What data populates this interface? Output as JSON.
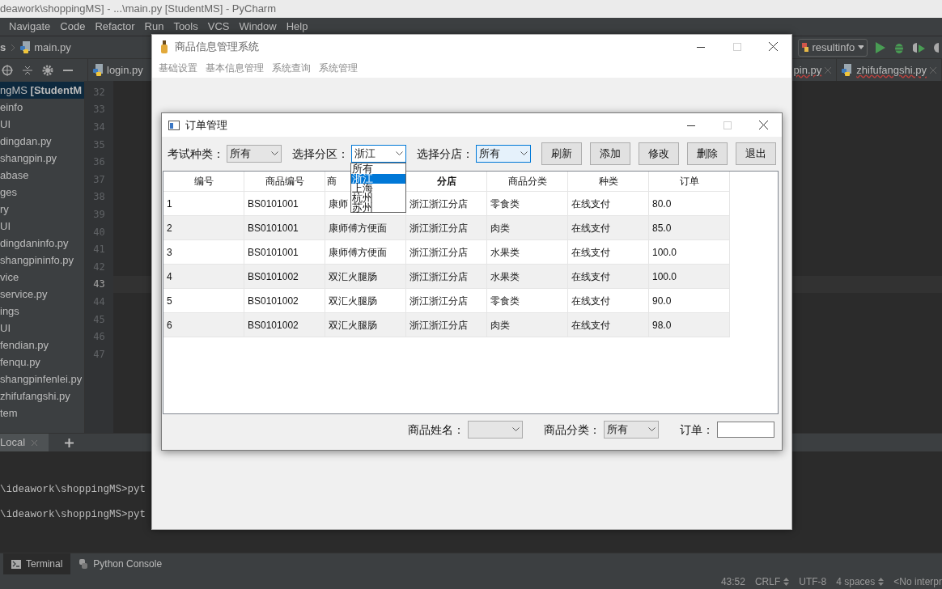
{
  "ide": {
    "title": "deawork\\shoppingMS] - ...\\main.py [StudentMS] - PyCharm",
    "menu": [
      "Navigate",
      "Code",
      "Refactor",
      "Run",
      "Tools",
      "VCS",
      "Window",
      "Help"
    ],
    "breadcrumb": [
      "s",
      "main.py"
    ],
    "run_config": "resultinfo",
    "editor_tabs_left": [
      "login.py"
    ],
    "editor_tabs_right": [
      "pin.py",
      "zhifufangshi.py"
    ],
    "project_items": [
      {
        "label": "ngMS **[StudentM**",
        "selected": true
      },
      {
        "label": "einfo",
        "selected": false
      },
      {
        "label": "UI",
        "selected": false
      },
      {
        "label": "dingdan.py",
        "selected": false
      },
      {
        "label": "shangpin.py",
        "selected": false
      },
      {
        "label": "abase",
        "selected": false
      },
      {
        "label": "ges",
        "selected": false
      },
      {
        "label": "ry",
        "selected": false
      },
      {
        "label": "UI",
        "selected": false
      },
      {
        "label": "dingdaninfo.py",
        "selected": false
      },
      {
        "label": "shangpininfo.py",
        "selected": false
      },
      {
        "label": "vice",
        "selected": false
      },
      {
        "label": "service.py",
        "selected": false
      },
      {
        "label": "ings",
        "selected": false
      },
      {
        "label": "UI",
        "selected": false
      },
      {
        "label": "fendian.py",
        "selected": false
      },
      {
        "label": "fenqu.py",
        "selected": false
      },
      {
        "label": "shangpinfenlei.py",
        "selected": false
      },
      {
        "label": "zhifufangshi.py",
        "selected": false
      },
      {
        "label": "tem",
        "selected": false
      }
    ],
    "line_numbers": [
      {
        "text": "32",
        "current": false
      },
      {
        "text": "33",
        "current": false
      },
      {
        "text": "34",
        "current": false
      },
      {
        "text": "35",
        "current": false
      },
      {
        "text": "36",
        "current": false
      },
      {
        "text": "37",
        "current": false
      },
      {
        "text": "38",
        "current": false
      },
      {
        "text": "39",
        "current": false
      },
      {
        "text": "40",
        "current": false
      },
      {
        "text": "41",
        "current": false
      },
      {
        "text": "42",
        "current": false
      },
      {
        "text": "43",
        "current": true
      },
      {
        "text": "44",
        "current": false
      },
      {
        "text": "45",
        "current": false
      },
      {
        "text": "46",
        "current": false
      },
      {
        "text": "47",
        "current": false
      }
    ],
    "terminal": {
      "tab": "Local",
      "lines": [
        "\\ideawork\\shoppingMS>pyt",
        "\\ideawork\\shoppingMS>pyt"
      ]
    },
    "tool_tabs": [
      {
        "label": "Terminal",
        "selected": true
      },
      {
        "label": "Python Console",
        "selected": false
      }
    ],
    "status_bar": [
      {
        "text": "43:52",
        "kind": "plain"
      },
      {
        "text": "CRLF",
        "kind": "menu"
      },
      {
        "text": "UTF-8",
        "kind": "plain"
      },
      {
        "text": "4 spaces",
        "kind": "menu"
      },
      {
        "text": "<No interpr",
        "kind": "plain"
      }
    ]
  },
  "app": {
    "title": "商品信息管理系统",
    "menu": [
      "基础设置",
      "基本信息管理",
      "系统查询",
      "系统管理"
    ],
    "dialog": {
      "title": "订单管理",
      "filters": [
        {
          "label": "考试种类：",
          "value": "所有",
          "focused": false,
          "hovered": false
        },
        {
          "label": "选择分区：",
          "value": "浙江",
          "focused": true,
          "hovered": false
        },
        {
          "label": "选择分店：",
          "value": "所有",
          "focused": false,
          "hovered": true
        }
      ],
      "buttons": [
        "刷新",
        "添加",
        "修改",
        "删除",
        "退出"
      ],
      "dropdown": [
        {
          "label": "所有",
          "selected": false
        },
        {
          "label": "浙江",
          "selected": true
        },
        {
          "label": "上海",
          "selected": false
        },
        {
          "label": "杭州",
          "selected": false
        },
        {
          "label": "苏州",
          "selected": false
        }
      ],
      "table": {
        "columns": [
          {
            "label": "编号",
            "sorted": false
          },
          {
            "label": "商品编号",
            "sorted": false
          },
          {
            "label": "商",
            "sorted": false
          },
          {
            "label": "分店",
            "sorted": true
          },
          {
            "label": "商品分类",
            "sorted": false
          },
          {
            "label": "种类",
            "sorted": false
          },
          {
            "label": "订单",
            "sorted": false
          }
        ],
        "rows": [
          [
            "1",
            "BS0101001",
            "康师",
            "浙江浙江分店",
            "零食类",
            "在线支付",
            "80.0"
          ],
          [
            "2",
            "BS0101001",
            "康师傅方便面",
            "浙江浙江分店",
            "肉类",
            "在线支付",
            "85.0"
          ],
          [
            "3",
            "BS0101001",
            "康师傅方便面",
            "浙江浙江分店",
            "水果类",
            "在线支付",
            "100.0"
          ],
          [
            "4",
            "BS0101002",
            "双汇火腿肠",
            "浙江浙江分店",
            "水果类",
            "在线支付",
            "100.0"
          ],
          [
            "5",
            "BS0101002",
            "双汇火腿肠",
            "浙江浙江分店",
            "零食类",
            "在线支付",
            "90.0"
          ],
          [
            "6",
            "BS0101002",
            "双汇火腿肠",
            "浙江浙江分店",
            "肉类",
            "在线支付",
            "98.0"
          ]
        ]
      },
      "bottom_filters": [
        {
          "label": "商品姓名：",
          "kind": "combo"
        },
        {
          "label": "商品分类：",
          "kind": "combo",
          "value": "所有"
        },
        {
          "label": "订单：",
          "kind": "input"
        }
      ]
    }
  }
}
